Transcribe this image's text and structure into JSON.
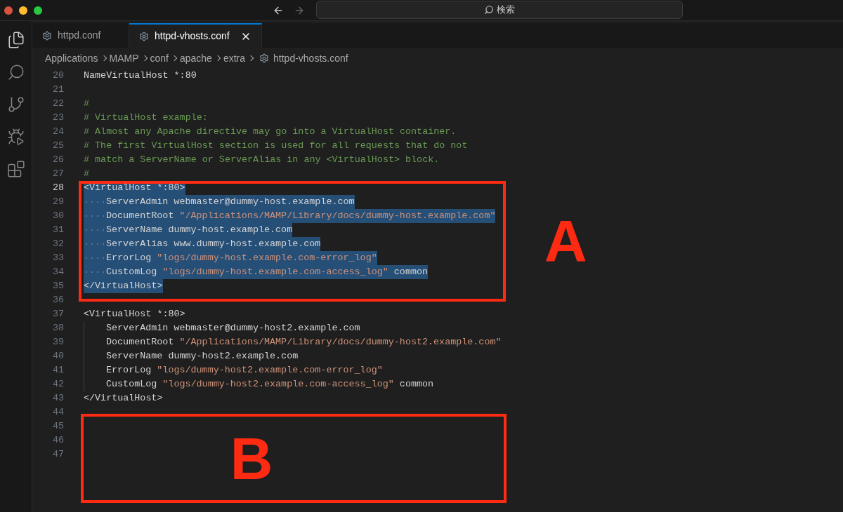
{
  "window": {
    "search_label": "検索"
  },
  "tabs": [
    {
      "label": "httpd.conf",
      "selected": false
    },
    {
      "label": "httpd-vhosts.conf",
      "selected": true
    }
  ],
  "breadcrumbs": [
    "Applications",
    "MAMP",
    "conf",
    "apache",
    "extra",
    "httpd-vhosts.conf"
  ],
  "lines": [
    {
      "number": "20",
      "current": false,
      "selected": false,
      "indent": false,
      "segments": [
        {
          "kind": "plain",
          "text": "NameVirtualHost *:80"
        }
      ]
    },
    {
      "number": "21",
      "current": false,
      "indent": false
    },
    {
      "number": "22",
      "current": false,
      "selected": false,
      "indent": false,
      "segments": [
        {
          "kind": "comment",
          "text": "#"
        }
      ]
    },
    {
      "number": "23",
      "current": false,
      "selected": false,
      "indent": false,
      "segments": [
        {
          "kind": "comment",
          "text": "# VirtualHost example:"
        }
      ]
    },
    {
      "number": "24",
      "current": false,
      "selected": false,
      "indent": false,
      "segments": [
        {
          "kind": "comment",
          "text": "# Almost any Apache directive may go into a VirtualHost container."
        }
      ]
    },
    {
      "number": "25",
      "current": false,
      "selected": false,
      "indent": false,
      "segments": [
        {
          "kind": "comment",
          "text": "# The first VirtualHost section is used for all requests that do not"
        }
      ]
    },
    {
      "number": "26",
      "current": false,
      "selected": false,
      "indent": false,
      "segments": [
        {
          "kind": "comment",
          "text": "# match a ServerName or ServerAlias in any <VirtualHost> block."
        }
      ]
    },
    {
      "number": "27",
      "current": false,
      "selected": false,
      "indent": false,
      "segments": [
        {
          "kind": "comment",
          "text": "#"
        }
      ]
    },
    {
      "number": "28",
      "current": true,
      "selected": true,
      "indent": false,
      "segments": [
        {
          "kind": "plain",
          "text": "<VirtualHost *:80>"
        }
      ]
    },
    {
      "number": "29",
      "current": false,
      "selected": true,
      "indent": true,
      "segments": [
        {
          "kind": "plain",
          "text": "ServerAdmin webmaster@dummy-host.example.com"
        }
      ]
    },
    {
      "number": "30",
      "current": false,
      "selected": true,
      "indent": true,
      "segments": [
        {
          "kind": "plain",
          "text": "DocumentRoot "
        },
        {
          "kind": "string",
          "text": "\"/Applications/MAMP/Library/docs/dummy-host.example.com\""
        }
      ]
    },
    {
      "number": "31",
      "current": false,
      "selected": true,
      "indent": true,
      "segments": [
        {
          "kind": "plain",
          "text": "ServerName dummy-host.example.com"
        }
      ]
    },
    {
      "number": "32",
      "current": false,
      "selected": true,
      "indent": true,
      "segments": [
        {
          "kind": "plain",
          "text": "ServerAlias www.dummy-host.example.com"
        }
      ]
    },
    {
      "number": "33",
      "current": false,
      "selected": true,
      "indent": true,
      "segments": [
        {
          "kind": "plain",
          "text": "ErrorLog "
        },
        {
          "kind": "string",
          "text": "\"logs/dummy-host.example.com-error_log\""
        }
      ]
    },
    {
      "number": "34",
      "current": false,
      "selected": true,
      "indent": true,
      "segments": [
        {
          "kind": "plain",
          "text": "CustomLog "
        },
        {
          "kind": "string",
          "text": "\"logs/dummy-host.example.com-access_log\""
        },
        {
          "kind": "plain",
          "text": " common"
        }
      ]
    },
    {
      "number": "35",
      "current": false,
      "selected": true,
      "indent": false,
      "segments": [
        {
          "kind": "plain",
          "text": "</VirtualHost>"
        }
      ]
    },
    {
      "number": "36",
      "current": false,
      "indent": false
    },
    {
      "number": "37",
      "current": false,
      "selected": false,
      "indent": false,
      "segments": [
        {
          "kind": "plain",
          "text": "<VirtualHost *:80>"
        }
      ]
    },
    {
      "number": "38",
      "current": false,
      "selected": false,
      "indent": true,
      "segments": [
        {
          "kind": "plain",
          "text": "ServerAdmin webmaster@dummy-host2.example.com"
        }
      ]
    },
    {
      "number": "39",
      "current": false,
      "selected": false,
      "indent": true,
      "segments": [
        {
          "kind": "plain",
          "text": "DocumentRoot "
        },
        {
          "kind": "string",
          "text": "\"/Applications/MAMP/Library/docs/dummy-host2.example.com\""
        }
      ]
    },
    {
      "number": "40",
      "current": false,
      "selected": false,
      "indent": true,
      "segments": [
        {
          "kind": "plain",
          "text": "ServerName dummy-host2.example.com"
        }
      ]
    },
    {
      "number": "41",
      "current": false,
      "selected": false,
      "indent": true,
      "segments": [
        {
          "kind": "plain",
          "text": "ErrorLog "
        },
        {
          "kind": "string",
          "text": "\"logs/dummy-host2.example.com-error_log\""
        }
      ]
    },
    {
      "number": "42",
      "current": false,
      "selected": false,
      "indent": true,
      "segments": [
        {
          "kind": "plain",
          "text": "CustomLog "
        },
        {
          "kind": "string",
          "text": "\"logs/dummy-host2.example.com-access_log\""
        },
        {
          "kind": "plain",
          "text": " common"
        }
      ]
    },
    {
      "number": "43",
      "current": false,
      "selected": false,
      "indent": false,
      "segments": [
        {
          "kind": "plain",
          "text": "</VirtualHost>"
        }
      ]
    },
    {
      "number": "44",
      "current": false,
      "indent": false
    },
    {
      "number": "45",
      "current": false,
      "indent": false
    },
    {
      "number": "46",
      "current": false,
      "indent": false
    },
    {
      "number": "47",
      "current": false,
      "indent": false
    }
  ],
  "annotations": [
    {
      "label": "A"
    },
    {
      "label": "B"
    }
  ]
}
